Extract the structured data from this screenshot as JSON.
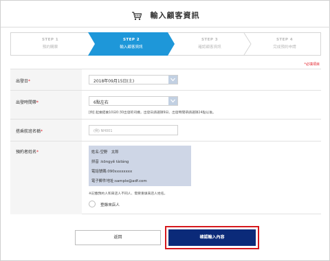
{
  "header": {
    "title": "輸入顧客資訊",
    "icon": "shopping-cart-icon"
  },
  "steps": [
    {
      "num": "STEP 1",
      "name": "預約購票",
      "state": "done"
    },
    {
      "num": "STEP 2",
      "name": "輸入顧客資訊",
      "state": "active"
    },
    {
      "num": "STEP 3",
      "name": "確認顧客資訊",
      "state": "todo"
    },
    {
      "num": "STEP 4",
      "name": "完成預約申請",
      "state": "todo"
    }
  ],
  "required_note": "*必填項目",
  "form": {
    "departure_date": {
      "label": "出發日",
      "value": "2018年09月15日(土)"
    },
    "departure_time": {
      "label": "出發時間帶",
      "value": "6點左右",
      "note": "[例] 起乘搭乘10日0:30出發的司機，出發日請選擇9日、出發時間帶請選擇24點以後。"
    },
    "flight_name": {
      "label": "搭乘航班名稱",
      "placeholder": "(例) NH001"
    },
    "reserver_name": {
      "label": "預約者姓名",
      "info_lines": [
        "姓名:空野　太郎",
        "拼音 :kōngyě tàiláng",
        "電話號碼:090xxxxxxxx",
        "電子郵件地址:sample@adf.com"
      ],
      "note": "※記載預約人和來店人不同人、需要重填來店人姓名。",
      "radio_label": "登錄來店人"
    }
  },
  "buttons": {
    "back": "返回",
    "confirm": "確認輸入內容"
  },
  "colors": {
    "accent_blue": "#1e97d9",
    "primary_navy": "#0b2a79",
    "required_red": "#e3222c",
    "highlight_red": "#d6171c",
    "info_box": "#ced6e6"
  }
}
